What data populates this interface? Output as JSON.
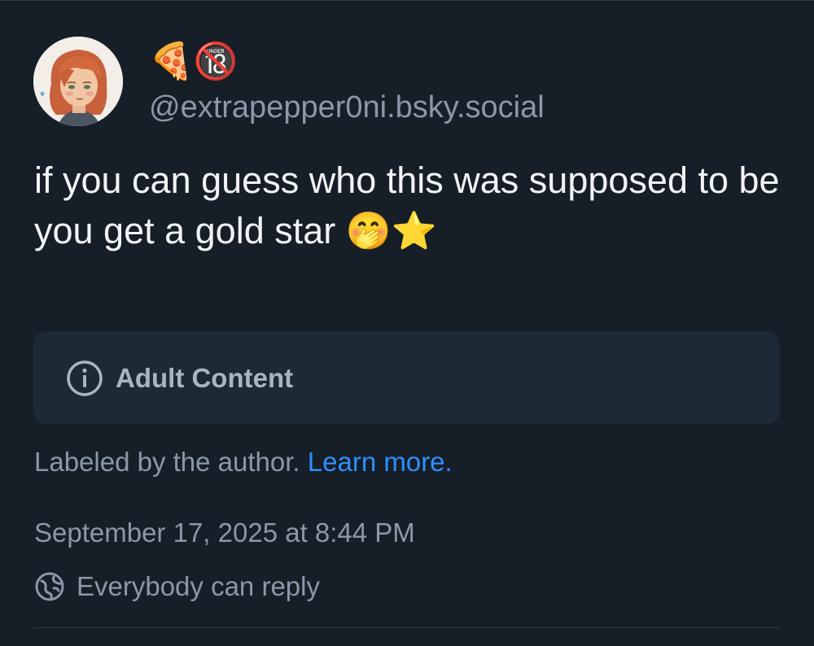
{
  "author": {
    "display_name": "🍕🔞",
    "handle": "@extrapepper0ni.bsky.social"
  },
  "post": {
    "text": "if you can guess who this was supposed to be you get a gold star 🤭⭐"
  },
  "content_warning": {
    "icon": "info-icon",
    "label": "Adult Content"
  },
  "label_note": {
    "text": "Labeled by the author.",
    "link_text": "Learn more."
  },
  "timestamp": "September 17, 2025 at 8:44 PM",
  "reply_setting": {
    "icon": "globe-icon",
    "label": "Everybody can reply"
  },
  "colors": {
    "background": "#161e27",
    "link": "#2f8fff",
    "muted_text": "#8b98a8",
    "warning_box": "#1e2936"
  }
}
